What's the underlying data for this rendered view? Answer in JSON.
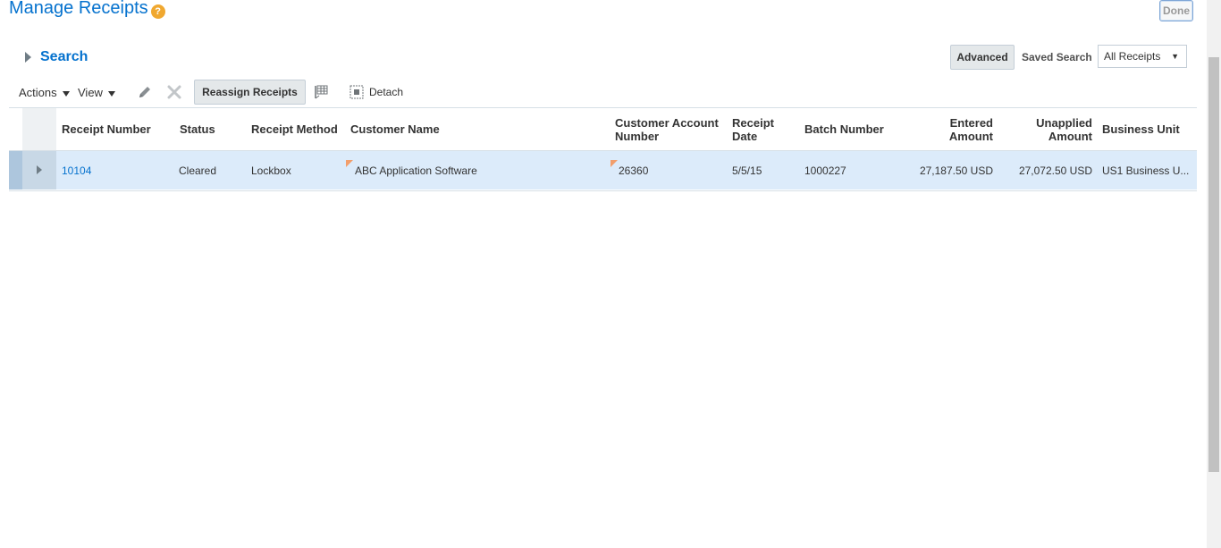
{
  "header": {
    "title": "Manage Receipts",
    "help_icon": "help-icon",
    "done_label": "Done"
  },
  "search": {
    "label": "Search",
    "advanced_label": "Advanced",
    "saved_search_label": "Saved Search",
    "saved_search_value": "All Receipts"
  },
  "toolbar": {
    "actions_label": "Actions",
    "view_label": "View",
    "edit_icon": "pencil-icon",
    "delete_icon": "close-icon",
    "reassign_label": "Reassign Receipts",
    "freeze_icon": "freeze-columns-icon",
    "detach_label": "Detach",
    "detach_icon": "detach-icon"
  },
  "table": {
    "columns": {
      "receipt_number": "Receipt Number",
      "status": "Status",
      "receipt_method": "Receipt Method",
      "customer_name": "Customer Name",
      "customer_account_line1": "Customer Account",
      "customer_account_line2": "Number",
      "receipt_date_line1": "Receipt",
      "receipt_date_line2": "Date",
      "batch_number": "Batch Number",
      "entered_amount_line1": "Entered",
      "entered_amount_line2": "Amount",
      "unapplied_amount_line1": "Unapplied",
      "unapplied_amount_line2": "Amount",
      "business_unit": "Business Unit"
    },
    "rows": [
      {
        "receipt_number": "10104",
        "status": "Cleared",
        "receipt_method": "Lockbox",
        "customer_name": "ABC Application Software",
        "customer_account": "26360",
        "receipt_date": "5/5/15",
        "batch_number": "1000227",
        "entered_amount": "27,187.50 USD",
        "unapplied_amount": "27,072.50 USD",
        "business_unit": "US1 Business U..."
      }
    ]
  },
  "colors": {
    "accent": "#0572ce",
    "selected_row": "#dcebfa",
    "flag": "#f29e6b",
    "help": "#f0a830"
  }
}
